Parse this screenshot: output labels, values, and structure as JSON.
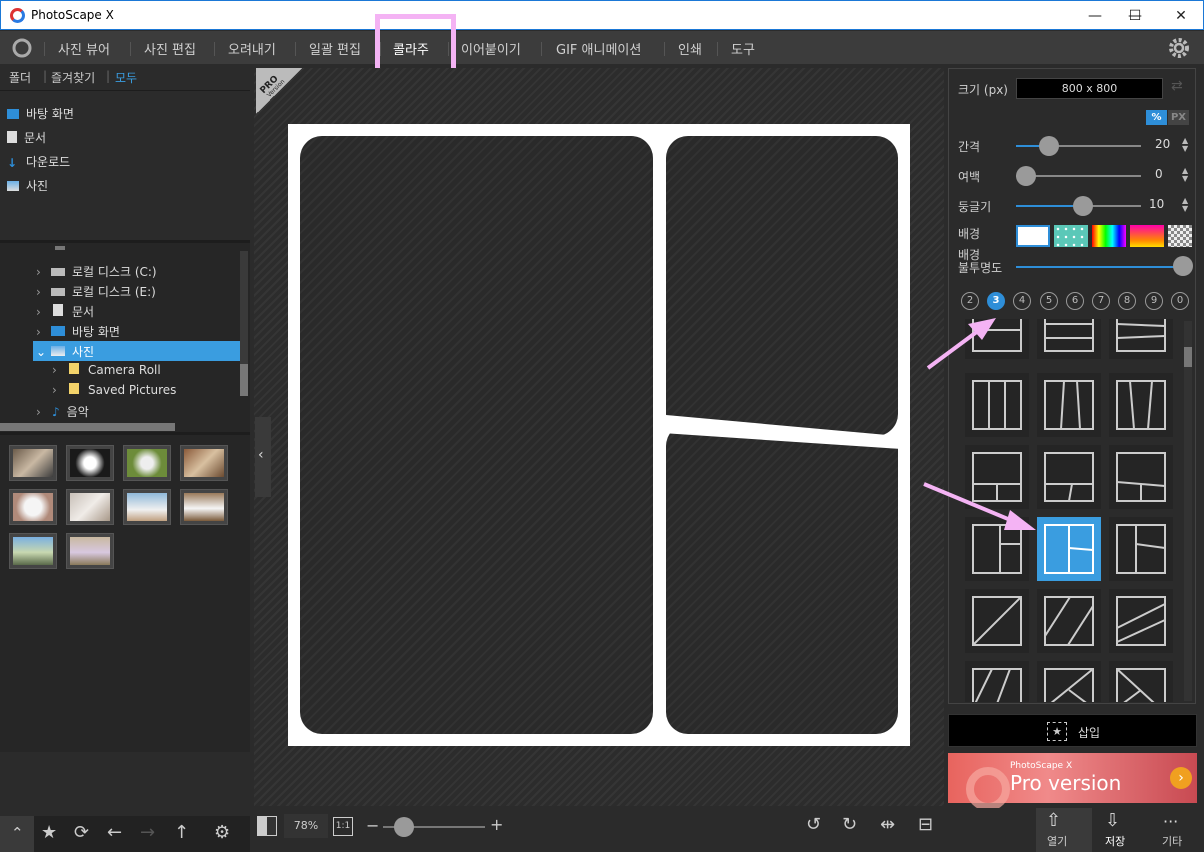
{
  "window": {
    "title": "PhotoScape X",
    "minimize": "—",
    "maximize": "☐",
    "close": "✕"
  },
  "menu": {
    "items": [
      "사진 뷰어",
      "사진 편집",
      "오려내기",
      "일괄 편집",
      "콜라주",
      "이어붙이기",
      "GIF 애니메이션",
      "인쇄",
      "도구"
    ],
    "active": "콜라주"
  },
  "left": {
    "tabs": [
      "폴더",
      "즐겨찾기",
      "모두"
    ],
    "favorites": [
      "바탕 화면",
      "문서",
      "다운로드",
      "사진"
    ],
    "tree": [
      "로컬 디스크 (C:)",
      "로컬 디스크 (E:)",
      "문서",
      "바탕 화면",
      "사진",
      "Camera Roll",
      "Saved Pictures",
      "음악"
    ],
    "selected": "사진"
  },
  "canvas": {
    "pro_badge": "PRO",
    "pro_sub": "Version"
  },
  "right": {
    "size_label": "크기 (px)",
    "size_value": "800 x 800",
    "unit_pct": "%",
    "unit_px": "PX",
    "spacing_label": "간격",
    "spacing_value": "20",
    "margin_label": "여백",
    "margin_value": "0",
    "round_label": "둥글기",
    "round_value": "10",
    "bg_label": "배경",
    "bg_opacity_label": "배경\n불투명도",
    "counts": [
      "2",
      "3",
      "4",
      "5",
      "6",
      "7",
      "8",
      "9",
      "0"
    ],
    "selected_count": "3",
    "insert_label": "삽입",
    "ad_line1": "PhotoScape X",
    "ad_line2": "Pro version"
  },
  "bottom": {
    "zoom": "78%",
    "ratio": "1:1",
    "open": "열기",
    "save": "저장",
    "more": "기타"
  },
  "colors": {
    "accent": "#2e8ed8",
    "highlight": "#f4b3f4",
    "selection": "#3a9de0"
  }
}
